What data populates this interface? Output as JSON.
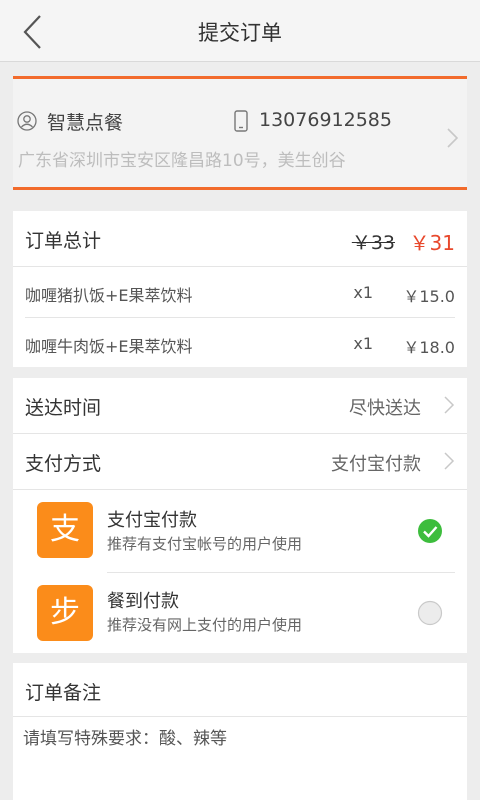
{
  "header": {
    "title": "提交订单",
    "back_icon": "chevron-left-icon"
  },
  "contact": {
    "name": "智慧点餐",
    "phone": "13076912585",
    "address": "广东省深圳市宝安区隆昌路10号，美生创谷",
    "accent_color": "#f26b2c"
  },
  "order": {
    "total_label": "订单总计",
    "original_price": "￥33",
    "final_price": "￥31",
    "price_color": "#e8482c",
    "items": [
      {
        "name": "咖喱猪扒饭+E果萃饮料",
        "qty": "x1",
        "price": "￥15.0"
      },
      {
        "name": "咖喱牛肉饭+E果萃饮料",
        "qty": "x1",
        "price": "￥18.0"
      }
    ]
  },
  "delivery": {
    "label": "送达时间",
    "value": "尽快送达"
  },
  "payment": {
    "label": "支付方式",
    "value": "支付宝付款",
    "options": [
      {
        "icon_char": "支",
        "title": "支付宝付款",
        "desc": "推荐有支付宝帐号的用户使用",
        "selected": true
      },
      {
        "icon_char": "步",
        "title": "餐到付款",
        "desc": "推荐没有网上支付的用户使用",
        "selected": false
      }
    ],
    "selected_color": "#3dbd3d"
  },
  "notes": {
    "label": "订单备注",
    "placeholder": "请填写特殊要求：酸、辣等"
  }
}
